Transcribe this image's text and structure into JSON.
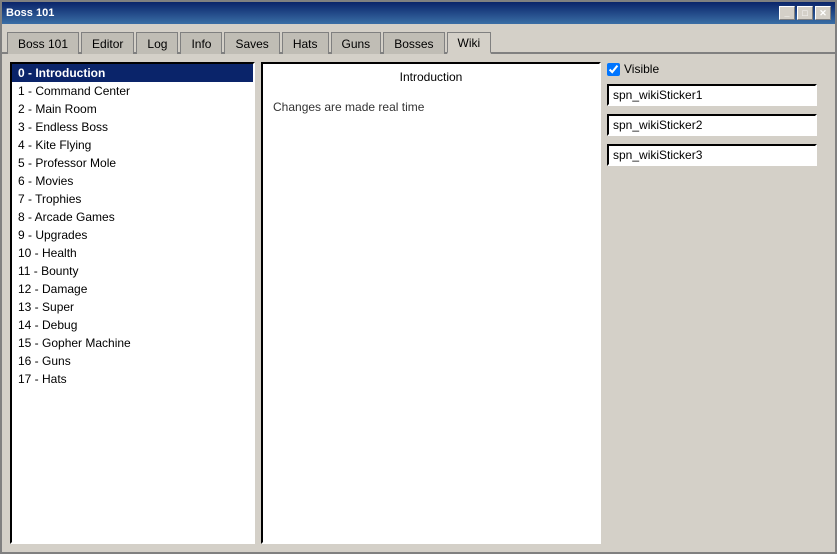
{
  "titleBar": {
    "title": "Boss 101",
    "minimizeLabel": "_",
    "maximizeLabel": "□",
    "closeLabel": "✕"
  },
  "tabs": [
    {
      "id": "boss101",
      "label": "Boss 101",
      "active": false
    },
    {
      "id": "editor",
      "label": "Editor",
      "active": false
    },
    {
      "id": "log",
      "label": "Log",
      "active": false
    },
    {
      "id": "info",
      "label": "Info",
      "active": false
    },
    {
      "id": "saves",
      "label": "Saves",
      "active": false
    },
    {
      "id": "hats",
      "label": "Hats",
      "active": false
    },
    {
      "id": "guns",
      "label": "Guns",
      "active": false
    },
    {
      "id": "bosses",
      "label": "Bosses",
      "active": false
    },
    {
      "id": "wiki",
      "label": "Wiki",
      "active": true
    }
  ],
  "leftPanel": {
    "items": [
      {
        "id": 0,
        "label": "0 - Introduction",
        "selected": true
      },
      {
        "id": 1,
        "label": "1 - Command Center",
        "selected": false
      },
      {
        "id": 2,
        "label": "2 - Main Room",
        "selected": false
      },
      {
        "id": 3,
        "label": "3 - Endless Boss",
        "selected": false
      },
      {
        "id": 4,
        "label": "4 - Kite Flying",
        "selected": false
      },
      {
        "id": 5,
        "label": "5 - Professor Mole",
        "selected": false
      },
      {
        "id": 6,
        "label": "6 - Movies",
        "selected": false
      },
      {
        "id": 7,
        "label": "7 - Trophies",
        "selected": false
      },
      {
        "id": 8,
        "label": "8 - Arcade Games",
        "selected": false
      },
      {
        "id": 9,
        "label": "9 - Upgrades",
        "selected": false
      },
      {
        "id": 10,
        "label": "10 - Health",
        "selected": false
      },
      {
        "id": 11,
        "label": "11 - Bounty",
        "selected": false
      },
      {
        "id": 12,
        "label": "12 - Damage",
        "selected": false
      },
      {
        "id": 13,
        "label": "13 - Super",
        "selected": false
      },
      {
        "id": 14,
        "label": "14 - Debug",
        "selected": false
      },
      {
        "id": 15,
        "label": "15 - Gopher Machine",
        "selected": false
      },
      {
        "id": 16,
        "label": "16 - Guns",
        "selected": false
      },
      {
        "id": 17,
        "label": "17 - Hats",
        "selected": false
      }
    ]
  },
  "middlePanel": {
    "title": "Introduction",
    "content": "Changes are made real time"
  },
  "rightPanel": {
    "visibleLabel": "Visible",
    "visibleChecked": true,
    "sticker1": "spn_wikiSticker1",
    "sticker2": "spn_wikiSticker2",
    "sticker3": "spn_wikiSticker3"
  }
}
